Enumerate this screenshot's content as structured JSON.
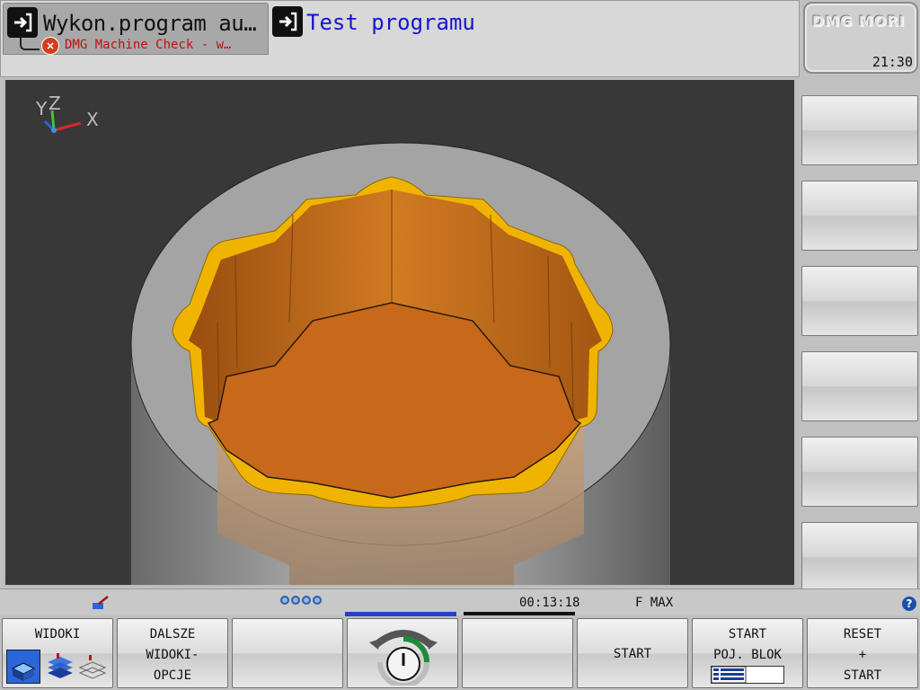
{
  "header": {
    "active_tab": {
      "title": "Wykon.program au…",
      "subtitle": "DMG Machine Check - w…"
    },
    "second_tab": {
      "title": "Test programu"
    }
  },
  "logo": {
    "text": "DMG MORI"
  },
  "clock": "21:30",
  "viewport": {
    "axis_labels": {
      "y": "Y",
      "z": "Z",
      "x": "X"
    },
    "colors": {
      "background": "#383838",
      "floor": "#d1751a",
      "walls": "#c36a17",
      "rim": "#f0b400",
      "stock": "#9a9a9a"
    }
  },
  "status": {
    "runtime": "00:13:18",
    "feed": "F MAX",
    "help": "?"
  },
  "softkeys": [
    {
      "lines": [
        "WIDOKI"
      ]
    },
    {
      "lines": [
        "DALSZE",
        "WIDOKI-",
        "OPCJE"
      ]
    },
    {
      "lines": []
    },
    {
      "lines": []
    },
    {
      "lines": []
    },
    {
      "lines": [
        "START"
      ]
    },
    {
      "lines": [
        "START",
        "POJ. BLOK"
      ]
    },
    {
      "lines": [
        "RESET",
        "+",
        "START"
      ]
    }
  ]
}
